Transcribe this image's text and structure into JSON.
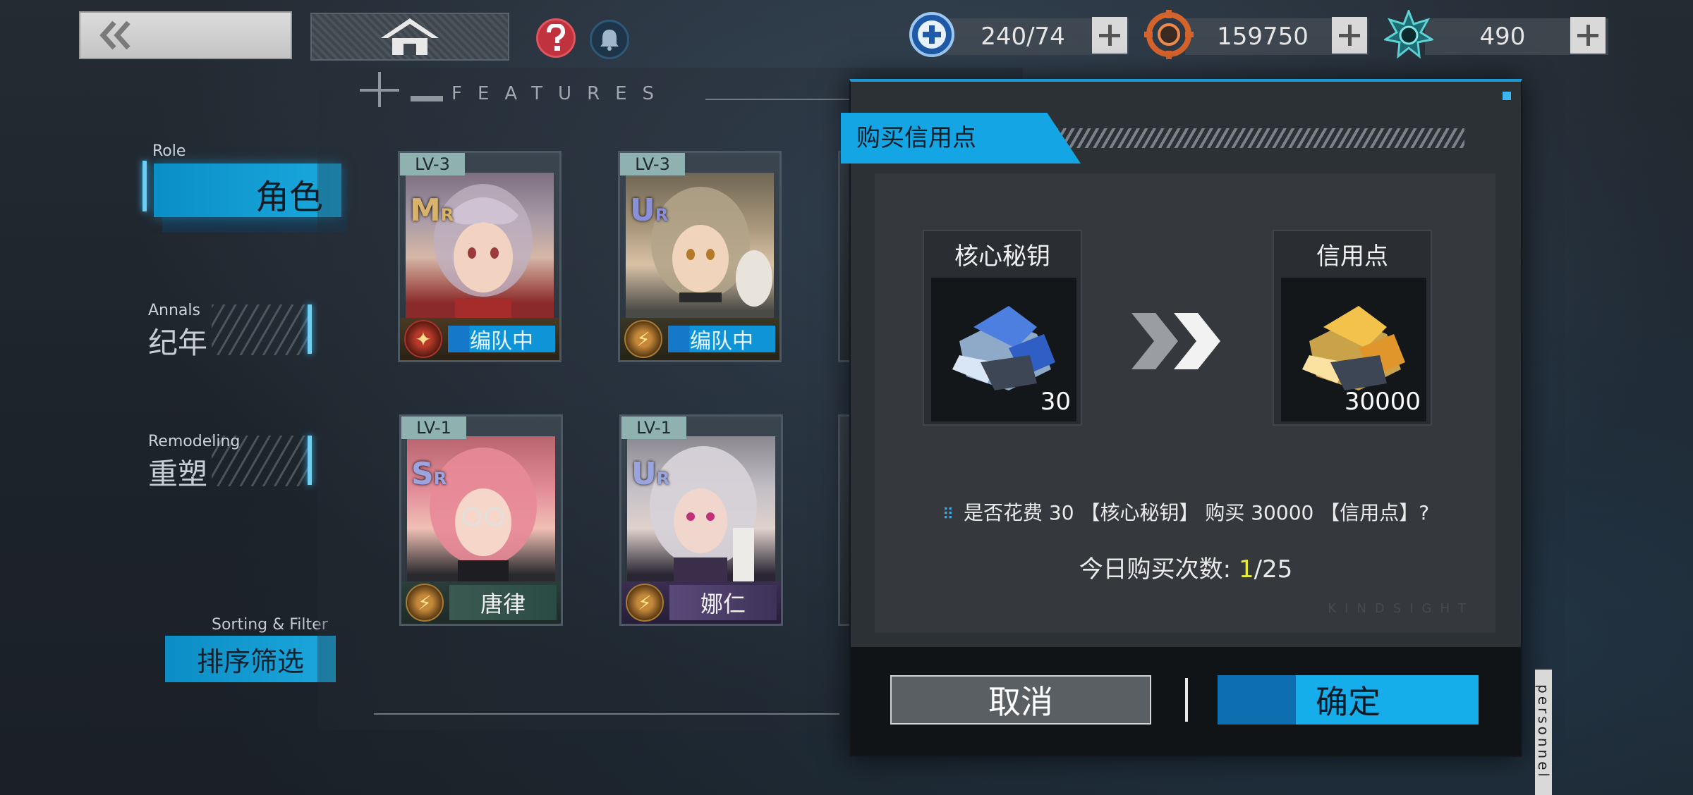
{
  "topbar": {
    "resources": [
      {
        "icon": "stamina-plus-icon",
        "value": "240/74"
      },
      {
        "icon": "credit-coin-icon",
        "value": "159750"
      },
      {
        "icon": "gear-crystal-icon",
        "value": "490"
      }
    ]
  },
  "nav": {
    "items": [
      {
        "en": "Role",
        "zh": "角色",
        "active": true
      },
      {
        "en": "Annals",
        "zh": "纪年",
        "active": false
      },
      {
        "en": "Remodeling",
        "zh": "重塑",
        "active": false
      }
    ],
    "filter": {
      "en": "Sorting & Filter",
      "zh": "排序筛选"
    }
  },
  "grid": {
    "features_label": "FEATURES",
    "cards": [
      {
        "level": "LV-3",
        "rank": "M",
        "rank_suffix": "R",
        "footer": "编队中",
        "in_team": true
      },
      {
        "level": "LV-3",
        "rank": "U",
        "rank_suffix": "R",
        "footer": "编队中",
        "in_team": true
      },
      {
        "level": "LV-1",
        "rank": "S",
        "rank_suffix": "R",
        "footer": "唐律",
        "in_team": false
      },
      {
        "level": "LV-1",
        "rank": "U",
        "rank_suffix": "R",
        "footer": "娜仁",
        "in_team": false
      }
    ]
  },
  "dialog": {
    "title": "购买信用点",
    "from": {
      "name": "核心秘钥",
      "qty": "30"
    },
    "to": {
      "name": "信用点",
      "qty": "30000"
    },
    "confirm_text": "是否花费 30 【核心秘钥】 购买 30000 【信用点】?",
    "count_label": "今日购买次数: ",
    "count_current": "1",
    "count_total": "/25",
    "cancel_label": "取消",
    "confirm_label": "确定",
    "watermark": "KINDSIGHT"
  },
  "side_strip": "personnel",
  "colors": {
    "accent": "#14a6e4",
    "count_highlight": "#e9ec3b",
    "danger": "#c0323e"
  }
}
